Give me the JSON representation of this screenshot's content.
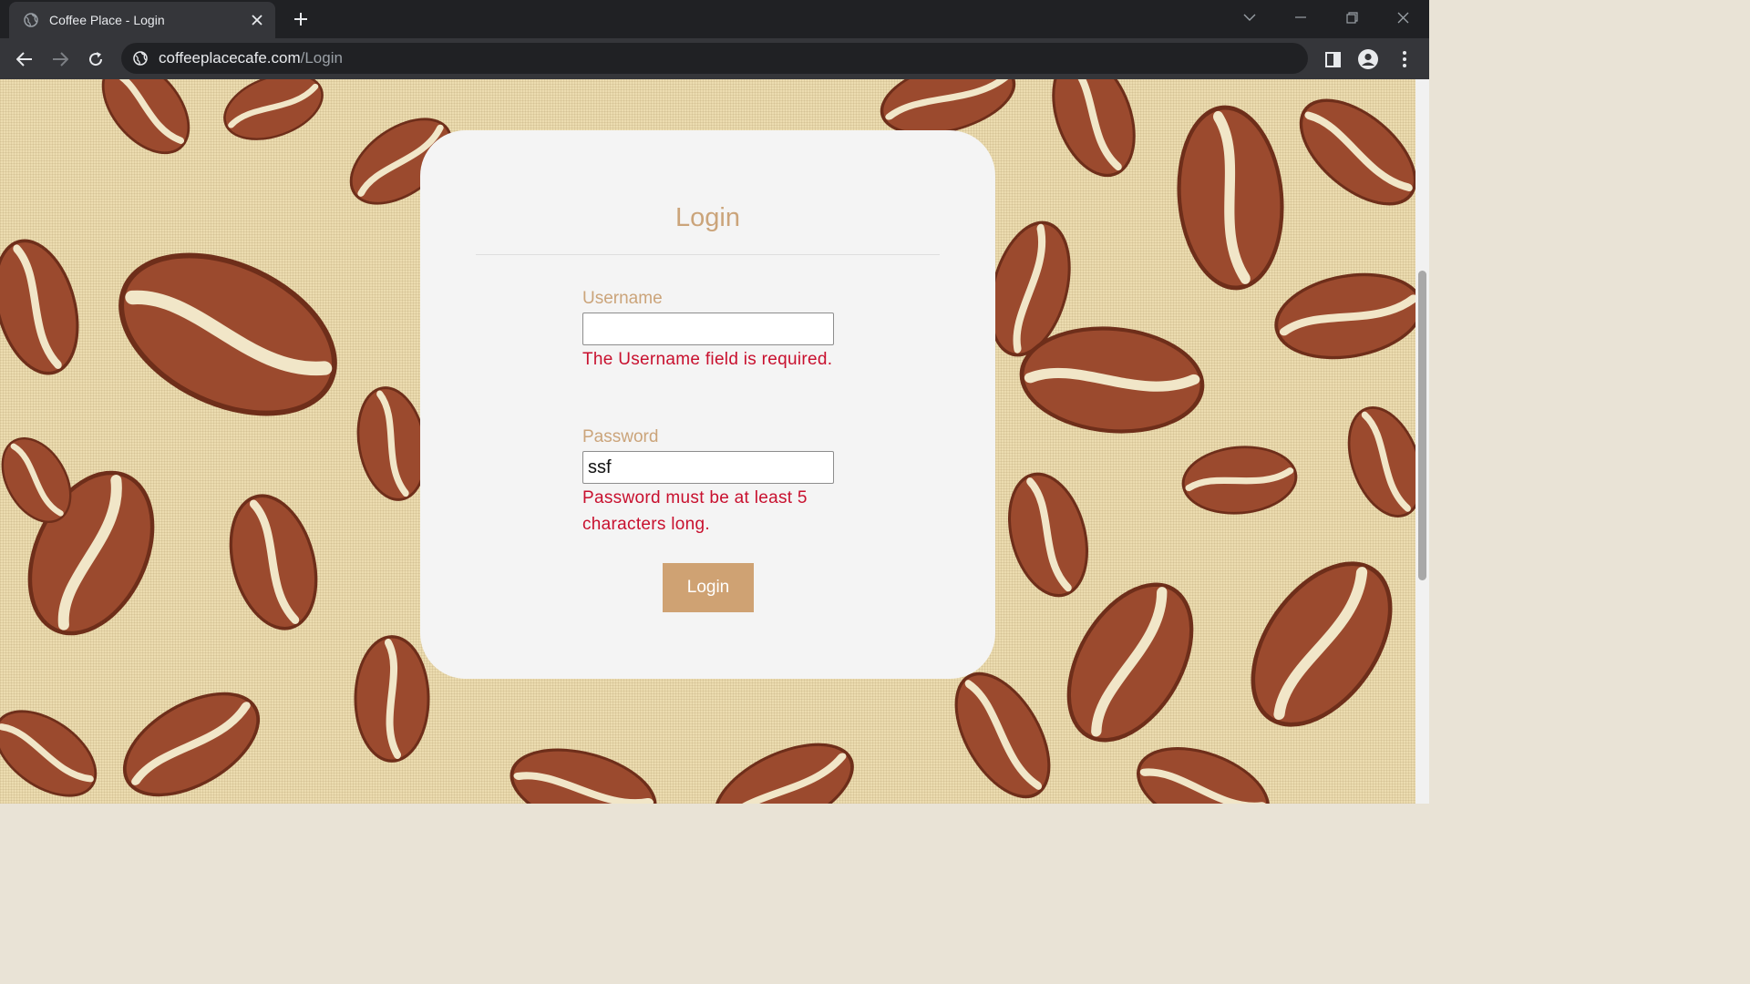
{
  "browser": {
    "tab_title": "Coffee Place - Login",
    "url_domain": "coffeeplacecafe.com",
    "url_path": "/Login"
  },
  "page": {
    "background": "coffee beans pattern",
    "card": {
      "title": "Login",
      "username": {
        "label": "Username",
        "value": "",
        "error": "The Username field is required."
      },
      "password": {
        "label": "Password",
        "value": "ssf",
        "error": "Password must be at least 5 characters long."
      },
      "submit_label": "Login"
    }
  },
  "colors": {
    "accent": "#cba47a",
    "button": "#cfa273",
    "error": "#c8102e",
    "card": "#f4f4f4"
  }
}
